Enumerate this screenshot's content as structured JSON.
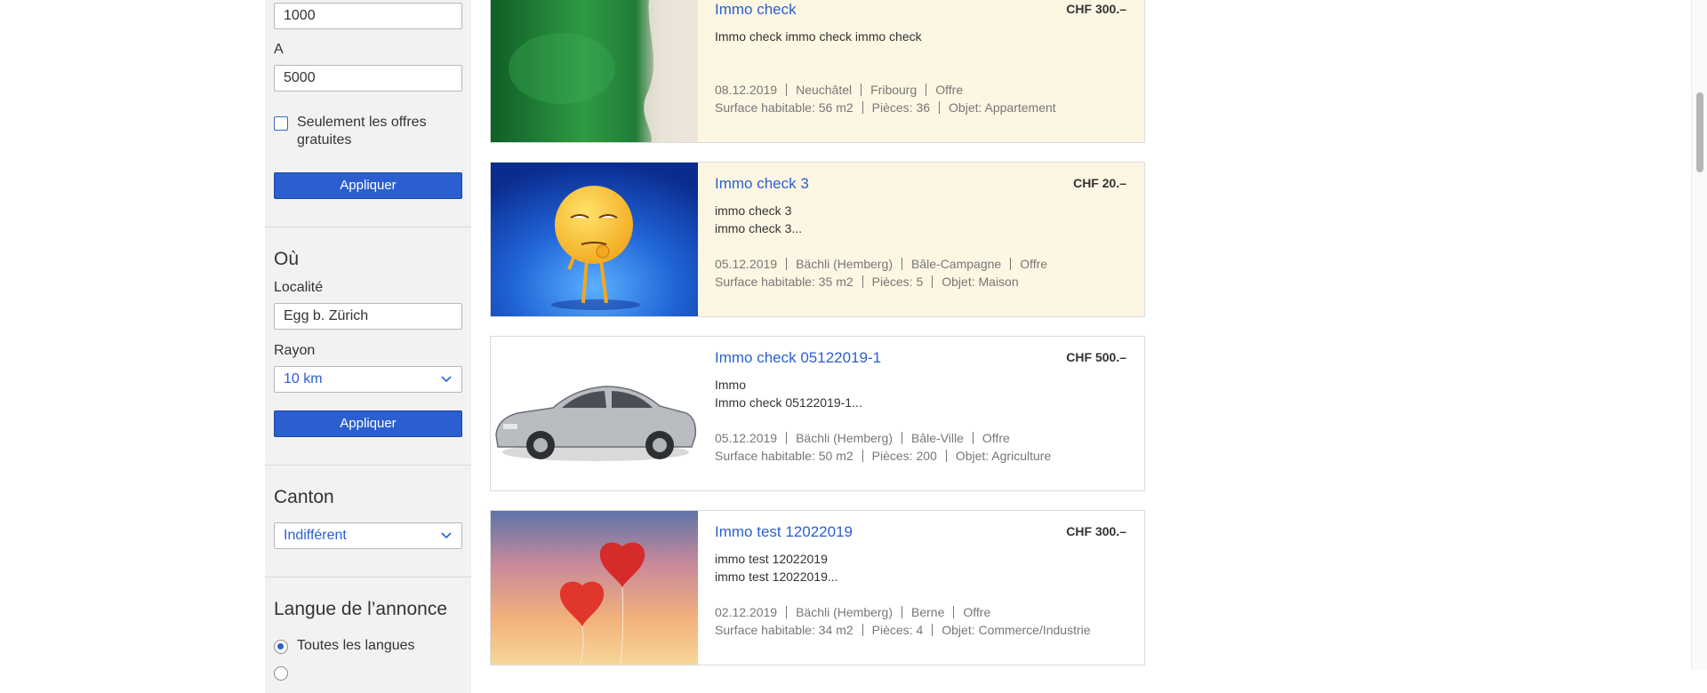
{
  "filters": {
    "price_from_value": "1000",
    "price_to_label": "A",
    "price_to_value": "5000",
    "free_only_label": "Seulement les offres gratuites",
    "apply_label": "Appliquer",
    "where": {
      "heading": "Où",
      "locality_label": "Localité",
      "locality_value": "Egg b. Zürich",
      "radius_label": "Rayon",
      "radius_value": "10 km",
      "apply_label": "Appliquer"
    },
    "canton": {
      "heading": "Canton",
      "value": "Indifférent"
    },
    "language": {
      "heading": "Langue de l’annonce",
      "option_all": "Toutes les langues"
    }
  },
  "listings": [
    {
      "title": "Immo check",
      "price": "CHF 300.–",
      "desc1": "Immo check immo check immo check",
      "desc2": "",
      "date": "08.12.2019",
      "place": "Neuchâtel",
      "canton": "Fribourg",
      "type": "Offre",
      "surface": "Surface habitable: 56 m2",
      "rooms": "Pièces: 36",
      "object": "Objet: Appartement",
      "highlighted": true
    },
    {
      "title": "Immo check 3",
      "price": "CHF 20.–",
      "desc1": "immo check 3",
      "desc2": "immo check 3...",
      "date": "05.12.2019",
      "place": "Bächli (Hemberg)",
      "canton": "Bâle-Campagne",
      "type": "Offre",
      "surface": "Surface habitable: 35 m2",
      "rooms": "Pièces: 5",
      "object": "Objet: Maison",
      "highlighted": true
    },
    {
      "title": "Immo check 05122019-1",
      "price": "CHF 500.–",
      "desc1": "Immo",
      "desc2": "Immo check 05122019-1...",
      "date": "05.12.2019",
      "place": "Bächli (Hemberg)",
      "canton": "Bâle-Ville",
      "type": "Offre",
      "surface": "Surface habitable: 50 m2",
      "rooms": "Pièces: 200",
      "object": "Objet: Agriculture",
      "highlighted": false
    },
    {
      "title": "Immo test 12022019",
      "price": "CHF 300.–",
      "desc1": "immo test 12022019",
      "desc2": "immo test 12022019...",
      "date": "02.12.2019",
      "place": "Bächli (Hemberg)",
      "canton": "Berne",
      "type": "Offre",
      "surface": "Surface habitable: 34 m2",
      "rooms": "Pièces: 4",
      "object": "Objet: Commerce/Industrie",
      "highlighted": false
    }
  ],
  "colors": {
    "accent": "#2b5fcf",
    "highlight_bg": "#fdf6e3",
    "sidebar_bg": "#f2f2f2"
  }
}
